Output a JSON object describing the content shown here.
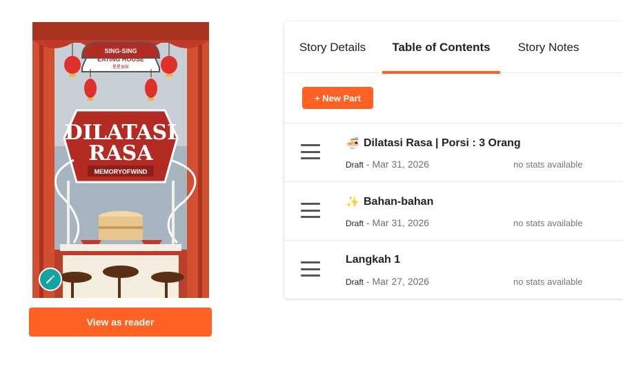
{
  "cover": {
    "sign_line1": "SING-SING",
    "sign_line2": "EATING HOUSE",
    "sign_line3": "星星食館",
    "title_line1": "DILATASI",
    "title_line2": "RASA",
    "author": "MEMORYOFWIND"
  },
  "actions": {
    "view_as_reader": "View as reader"
  },
  "tabs": [
    {
      "label": "Story Details",
      "active": false
    },
    {
      "label": "Table of Contents",
      "active": true
    },
    {
      "label": "Story Notes",
      "active": false
    }
  ],
  "toc": {
    "new_part_label": "+ New Part",
    "parts": [
      {
        "emoji": "🍜",
        "title": "Dilatasi Rasa | Porsi : 3 Orang",
        "status": "Draft",
        "separator": " - ",
        "date": "Mar 31, 2026",
        "stats": "no stats available"
      },
      {
        "emoji": "✨",
        "title": "Bahan-bahan",
        "status": "Draft",
        "separator": " - ",
        "date": "Mar 31, 2026",
        "stats": "no stats available"
      },
      {
        "emoji": "",
        "title": "Langkah 1",
        "status": "Draft",
        "separator": " - ",
        "date": "Mar 27, 2026",
        "stats": "no stats available"
      }
    ]
  },
  "colors": {
    "accent": "#ff6122",
    "edit_fab": "#14a3a3",
    "cover_red": "#c0392b"
  }
}
